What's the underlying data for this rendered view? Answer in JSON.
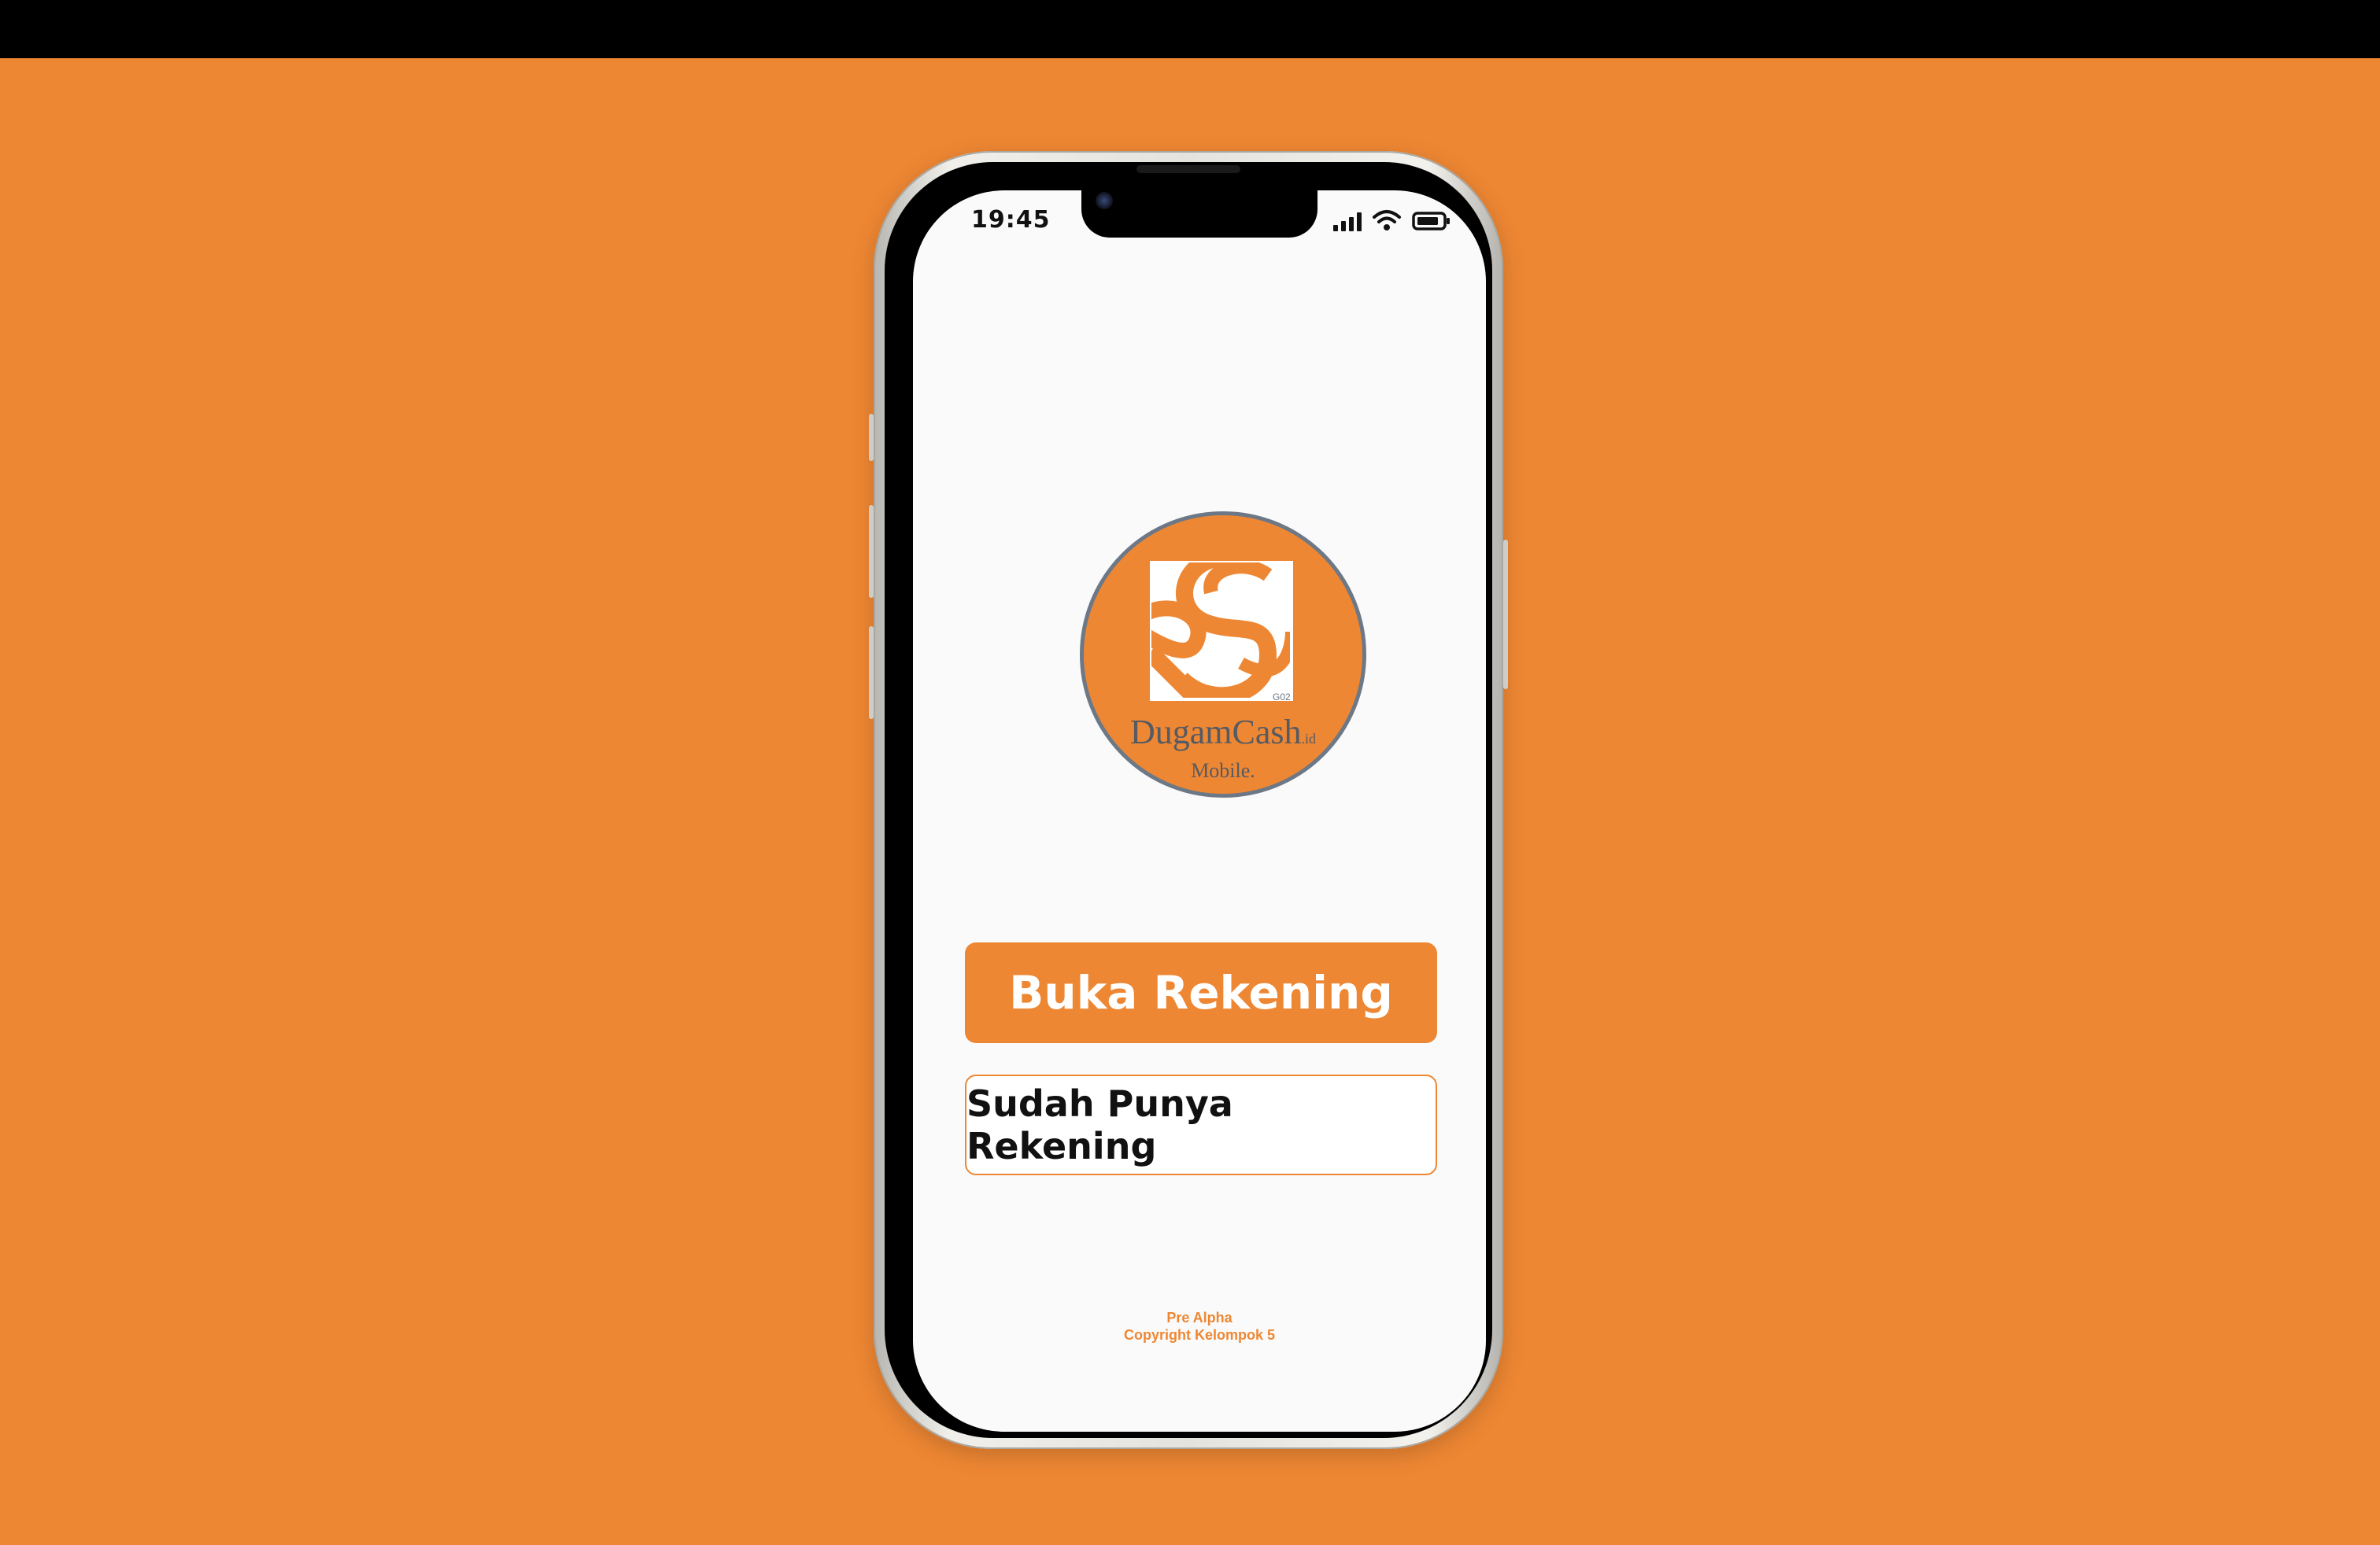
{
  "status_bar": {
    "time": "19:45"
  },
  "logo": {
    "small_code": "G02",
    "brand_name": "DugamCash",
    "brand_suffix": ".id",
    "tagline": "Mobile."
  },
  "actions": {
    "primary_label": "Buka Rekening",
    "secondary_label": "Sudah Punya Rekening"
  },
  "footer": {
    "version": "Pre Alpha",
    "copyright": "Copyright Kelompok 5"
  },
  "colors": {
    "background": "#ee8733",
    "accent": "#ee8733",
    "logo_border": "#6d7887",
    "screen": "#fafafa"
  },
  "icons": [
    "signal-icon",
    "wifi-icon",
    "battery-icon",
    "camera-icon"
  ]
}
